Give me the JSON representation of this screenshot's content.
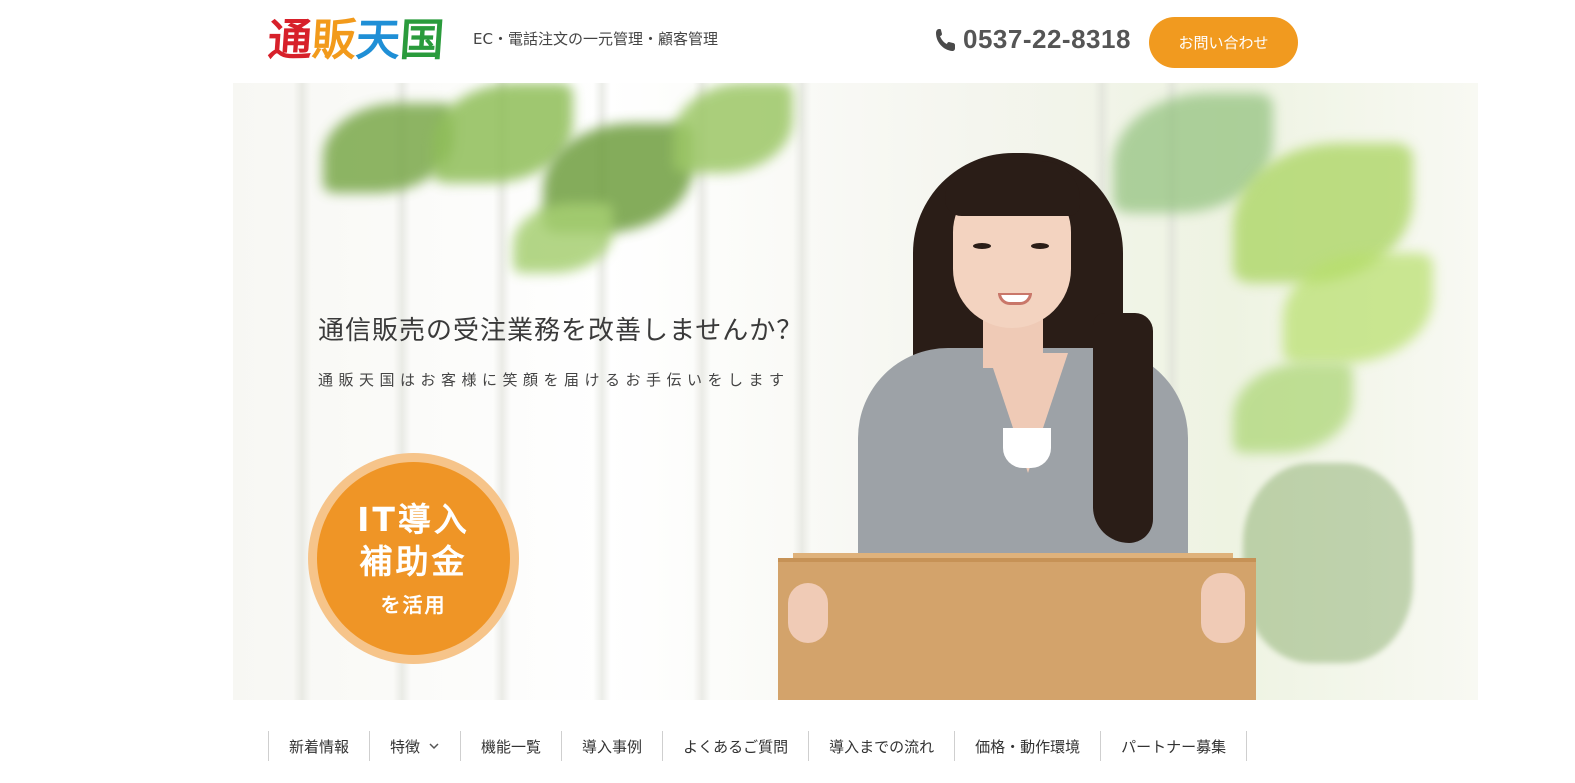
{
  "header": {
    "logo_chars": [
      {
        "text": "通",
        "color": "#d7202a"
      },
      {
        "text": "販",
        "color": "#f29a1b"
      },
      {
        "text": "天",
        "color": "#1f8fd6"
      },
      {
        "text": "国",
        "color": "#2a9b3c"
      }
    ],
    "tagline": "EC・電話注文の一元管理・顧客管理",
    "phone_icon": "phone-icon",
    "phone_number": "0537-22-8318",
    "contact_button": "お問い合わせ"
  },
  "hero": {
    "title": "通信販売の受注業務を改善しませんか？",
    "subtitle": "通販天国はお客様に笑顔を届けるお手伝いをします",
    "badge": {
      "line1": "IT導入",
      "line2": "補助金",
      "line3": "を活用"
    }
  },
  "nav": {
    "items": [
      {
        "label": "新着情報"
      },
      {
        "label": "特徴",
        "dropdown": true
      },
      {
        "label": "機能一覧"
      },
      {
        "label": "導入事例"
      },
      {
        "label": "よくあるご質問"
      },
      {
        "label": "導入までの流れ"
      },
      {
        "label": "価格・動作環境"
      },
      {
        "label": "パートナー募集"
      }
    ]
  },
  "colors": {
    "accent": "#f19a1f",
    "badge": "#ef9526",
    "text": "#333333"
  }
}
